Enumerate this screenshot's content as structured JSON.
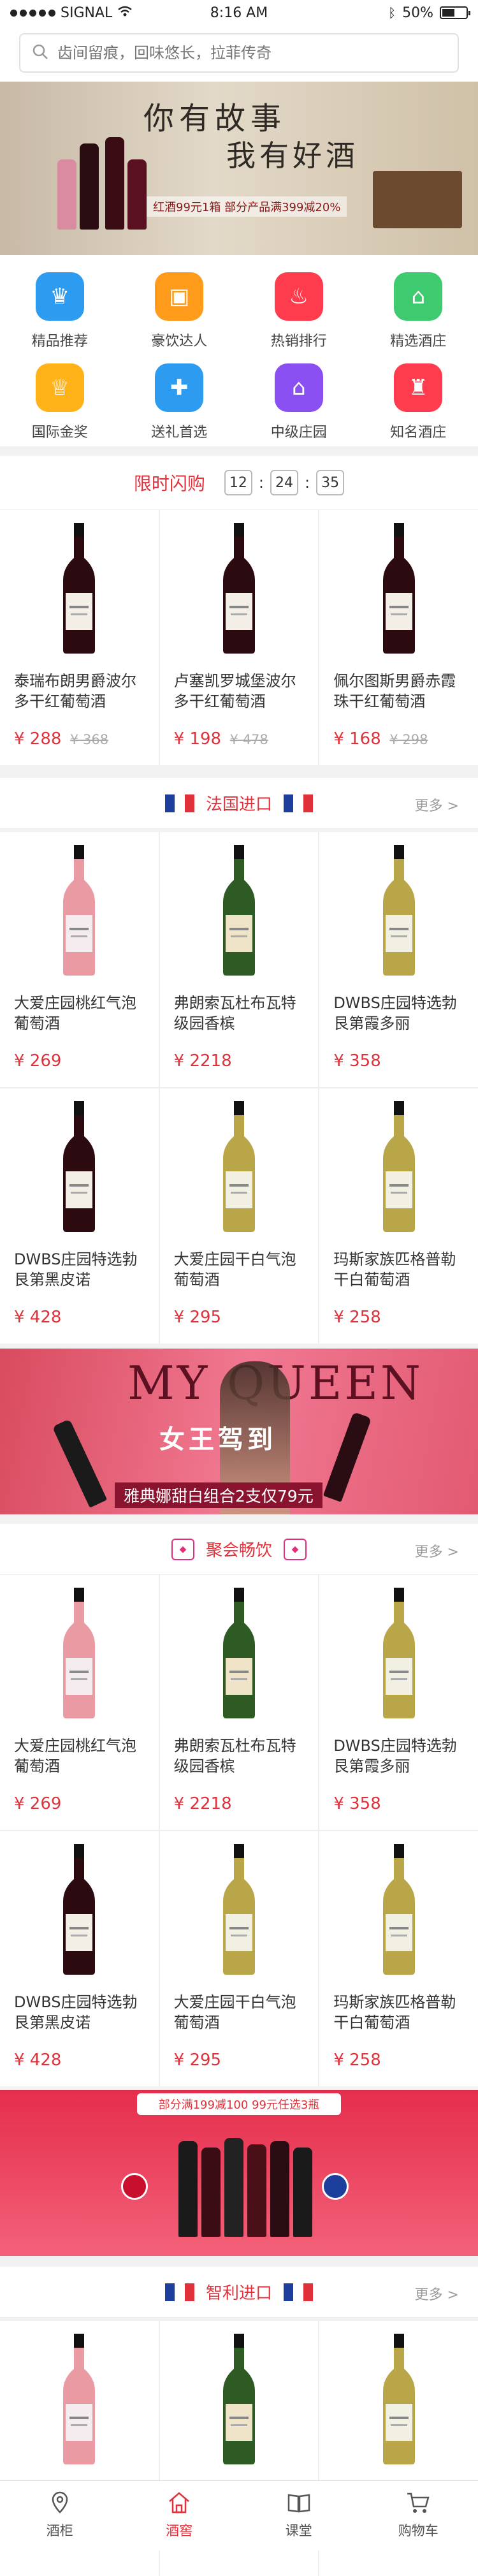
{
  "status": {
    "carrier": "SIGNAL",
    "time": "8:16 AM",
    "battery": "50%"
  },
  "search": {
    "placeholder": "齿间留痕，回味悠长，拉菲传奇"
  },
  "banner": {
    "title1": "你有故事",
    "title2": "我有好酒",
    "sub": "红酒99元1箱 部分产品满399减20%"
  },
  "categories": [
    {
      "label": "精品推荐",
      "icon": "crown-icon",
      "color": "#2d9cf0"
    },
    {
      "label": "豪饮达人",
      "icon": "box-icon",
      "color": "#ff9b1a"
    },
    {
      "label": "热销排行",
      "icon": "flame-icon",
      "color": "#ff3b4e"
    },
    {
      "label": "精选酒庄",
      "icon": "store-icon",
      "color": "#3ecb6f"
    },
    {
      "label": "国际金奖",
      "icon": "trophy-icon",
      "color": "#ffb319"
    },
    {
      "label": "送礼首选",
      "icon": "gift-icon",
      "color": "#2d9cf0"
    },
    {
      "label": "中级庄园",
      "icon": "house-icon",
      "color": "#8a4ff0"
    },
    {
      "label": "知名酒庄",
      "icon": "castle-icon",
      "color": "#ff3b4e"
    }
  ],
  "flash": {
    "label": "限时闪购",
    "h": "12",
    "m": "24",
    "s": "35"
  },
  "flash_products": [
    {
      "name": "泰瑞布朗男爵波尔多干红葡萄酒",
      "price": "¥ 288",
      "old": "¥ 368"
    },
    {
      "name": "卢塞凯罗城堡波尔多干红葡萄酒",
      "price": "¥ 198",
      "old": "¥ 478"
    },
    {
      "name": "佩尔图斯男爵赤霞珠干红葡萄酒",
      "price": "¥ 168",
      "old": "¥ 298"
    }
  ],
  "section_france": {
    "title": "法国进口",
    "more": "更多 >"
  },
  "products_a": [
    {
      "name": "大爱庄园桃红气泡葡萄酒",
      "price": "¥ 269",
      "bottle": "rose"
    },
    {
      "name": "弗朗索瓦杜布瓦特级园香槟",
      "price": "¥ 2218",
      "bottle": "green"
    },
    {
      "name": "DWBS庄园特选勃艮第霞多丽",
      "price": "¥ 358",
      "bottle": "white"
    },
    {
      "name": "DWBS庄园特选勃艮第黑皮诺",
      "price": "¥ 428",
      "bottle": "red"
    },
    {
      "name": "大爱庄园干白气泡葡萄酒",
      "price": "¥ 295",
      "bottle": "white"
    },
    {
      "name": "玛斯家族匹格普勒干白葡萄酒",
      "price": "¥ 258",
      "bottle": "white"
    }
  ],
  "promo1": {
    "brand": "MY QUEEN",
    "title": "女王驾到",
    "sub": "雅典娜甜白组合2支仅79元"
  },
  "section_party": {
    "title": "聚会畅饮",
    "more": "更多 >"
  },
  "products_b": [
    {
      "name": "大爱庄园桃红气泡葡萄酒",
      "price": "¥ 269",
      "bottle": "rose"
    },
    {
      "name": "弗朗索瓦杜布瓦特级园香槟",
      "price": "¥ 2218",
      "bottle": "green"
    },
    {
      "name": "DWBS庄园特选勃艮第霞多丽",
      "price": "¥ 358",
      "bottle": "white"
    },
    {
      "name": "DWBS庄园特选勃艮第黑皮诺",
      "price": "¥ 428",
      "bottle": "red"
    },
    {
      "name": "大爱庄园干白气泡葡萄酒",
      "price": "¥ 295",
      "bottle": "white"
    },
    {
      "name": "玛斯家族匹格普勒干白葡萄酒",
      "price": "¥ 258",
      "bottle": "white"
    }
  ],
  "promo2": {
    "top": "部分满199减100 99元任选3瓶"
  },
  "section_chile": {
    "title": "智利进口",
    "more": "更多 >"
  },
  "tabs": [
    {
      "label": "酒柜",
      "icon": "location-icon"
    },
    {
      "label": "酒窖",
      "icon": "home-icon"
    },
    {
      "label": "课堂",
      "icon": "book-icon"
    },
    {
      "label": "购物车",
      "icon": "cart-icon"
    }
  ]
}
